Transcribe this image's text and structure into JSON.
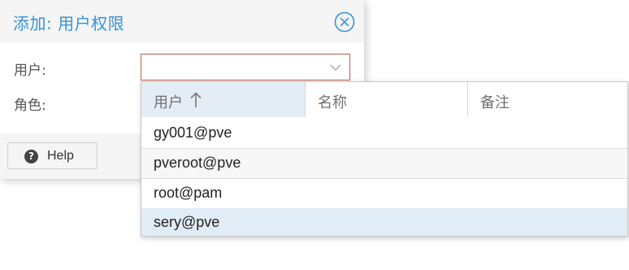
{
  "dialog": {
    "title": "添加: 用户权限",
    "close_icon": "close-circle-icon",
    "fields": {
      "user_label": "用户:",
      "role_label": "角色:"
    },
    "help_button": {
      "label": "Help",
      "icon": "question-circle-icon"
    }
  },
  "picker": {
    "columns": [
      {
        "label": "用户",
        "sort": "ascending",
        "sort_icon": "arrow-up-icon"
      },
      {
        "label": "名称"
      },
      {
        "label": "备注"
      }
    ],
    "rows": [
      {
        "user": "gy001@pve"
      },
      {
        "user": "pveroot@pve"
      },
      {
        "user": "root@pam"
      },
      {
        "user": "sery@pve",
        "highlighted": true
      }
    ]
  },
  "colors": {
    "title": "#3892d4",
    "invalid_field_border": "#b0624d",
    "sorted_column_header": "#e4edf6",
    "alt_row": "#f7f7f7",
    "highlighted_row": "#e0edf7"
  }
}
